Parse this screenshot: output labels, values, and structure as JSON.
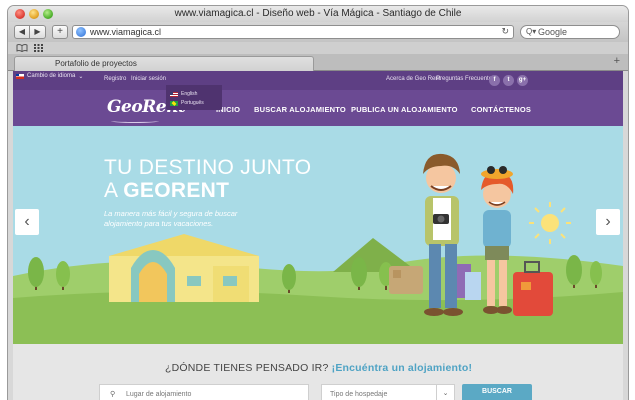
{
  "browser": {
    "window_title": "www.viamagica.cl - Diseño web - Vía Mágica - Santiago de Chile",
    "url": "www.viamagica.cl",
    "search_placeholder": "Google",
    "tab_label": "Portafolio de proyectos",
    "back_glyph": "◀",
    "forward_glyph": "▶",
    "add_glyph": "+",
    "reload_glyph": "↻",
    "tab_add_glyph": "+",
    "bookmark_book_glyph": "📖",
    "bookmark_grid_glyph": "▦",
    "search_glyph": "Q▾"
  },
  "topbar": {
    "login": "Registro",
    "signin": "Iniciar sesión",
    "language_label": "Cambio de idioma",
    "language_caret": "⌄",
    "about": "Acerca de Geo Rent",
    "faq": "Preguntas Frecuentes",
    "social": [
      "f",
      "t",
      "g+"
    ]
  },
  "language_menu": {
    "options": [
      "English",
      "Português"
    ]
  },
  "nav": {
    "logo": "GeoRent",
    "items": [
      "INICIO",
      "BUSCAR ALOJAMIENTO",
      "PUBLICA UN ALOJAMIENTO",
      "CONTÁCTENOS"
    ]
  },
  "hero": {
    "headline_line1": "TU DESTINO JUNTO",
    "headline_line2_prefix": "A ",
    "headline_line2_brand": "GEORENT",
    "tagline": "La manera más fácil y segura de buscar alojamiento para tus vacaciones.",
    "arrow_left": "‹",
    "arrow_right": "›"
  },
  "search": {
    "question": "¿DÓNDE TIENES PENSADO IR? ",
    "cta": "¡Encuéntra un alojamiento!",
    "location_placeholder": "Lugar de alojamiento",
    "location_icon": "⚲",
    "type_placeholder": "Tipo de hospedaje",
    "type_caret": "⌄",
    "button": "BUSCAR"
  },
  "colors": {
    "purple_topbar": "#5e3f84",
    "purple_nav": "#6b4a93",
    "sky": "#a9dbe6",
    "grass": "#8cbf55",
    "accent_blue": "#5ba9c5"
  }
}
